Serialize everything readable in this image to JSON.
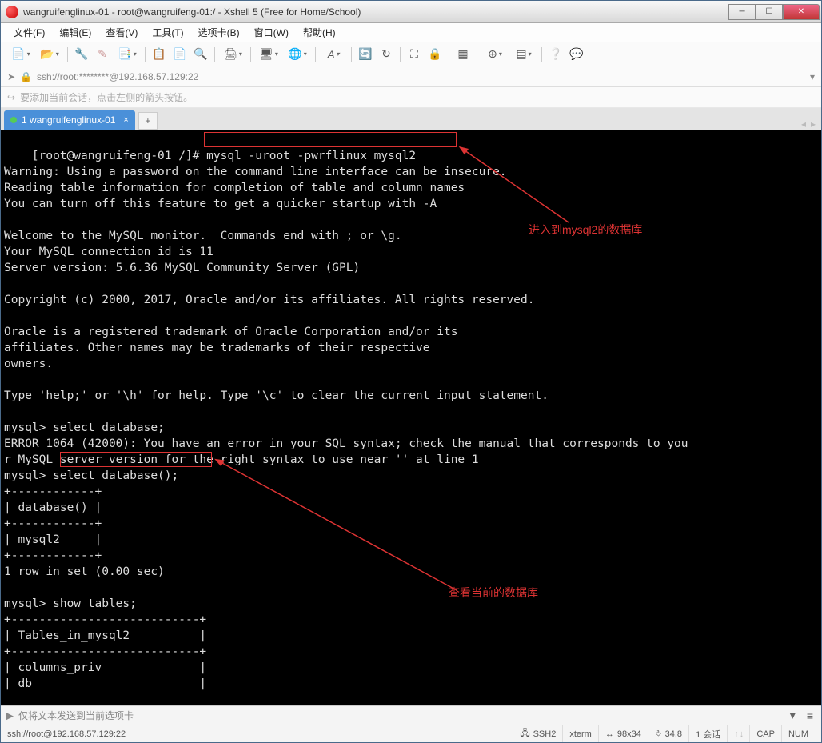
{
  "title": "wangruifenglinux-01 - root@wangruifeng-01:/ - Xshell 5 (Free for Home/School)",
  "menu": [
    "文件(F)",
    "编辑(E)",
    "查看(V)",
    "工具(T)",
    "选项卡(B)",
    "窗口(W)",
    "帮助(H)"
  ],
  "address": "ssh://root:********@192.168.57.129:22",
  "tip": "要添加当前会话，点击左侧的箭头按钮。",
  "tab": {
    "label": "1 wangruifenglinux-01"
  },
  "terminal_text": "[root@wangruifeng-01 /]# mysql -uroot -pwrflinux mysql2\nWarning: Using a password on the command line interface can be insecure.\nReading table information for completion of table and column names\nYou can turn off this feature to get a quicker startup with -A\n\nWelcome to the MySQL monitor.  Commands end with ; or \\g.\nYour MySQL connection id is 11\nServer version: 5.6.36 MySQL Community Server (GPL)\n\nCopyright (c) 2000, 2017, Oracle and/or its affiliates. All rights reserved.\n\nOracle is a registered trademark of Oracle Corporation and/or its\naffiliates. Other names may be trademarks of their respective\nowners.\n\nType 'help;' or '\\h' for help. Type '\\c' to clear the current input statement.\n\nmysql> select database;\nERROR 1064 (42000): You have an error in your SQL syntax; check the manual that corresponds to you\nr MySQL server version for the right syntax to use near '' at line 1\nmysql> select database();\n+------------+\n| database() |\n+------------+\n| mysql2     |\n+------------+\n1 row in set (0.00 sec)\n\nmysql> show tables;\n+---------------------------+\n| Tables_in_mysql2          |\n+---------------------------+\n| columns_priv              |\n| db                        |",
  "annotation1": "进入到mysql2的数据库",
  "annotation2": "查看当前的数据库",
  "input_placeholder": "仅将文本发送到当前选项卡",
  "status": {
    "left": "ssh://root@192.168.57.129:22",
    "ssh": "SSH2",
    "term": "xterm",
    "size": "98x34",
    "pos": "34,8",
    "sess": "1 会话",
    "cap": "CAP",
    "num": "NUM"
  }
}
